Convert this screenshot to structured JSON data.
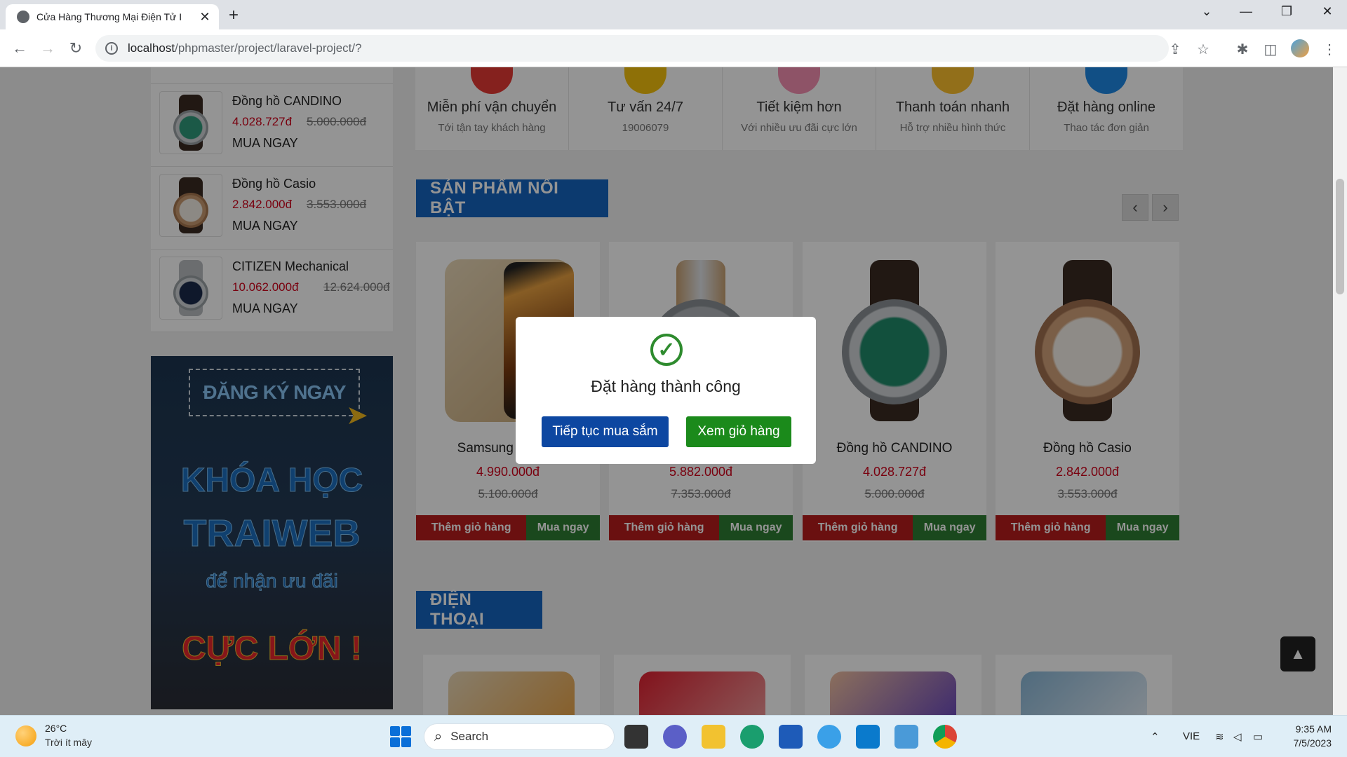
{
  "browser": {
    "tab_title": "Cửa Hàng Thương Mại Điện Tử I",
    "url_host": "localhost",
    "url_path": "/phpmaster/project/laravel-project/?",
    "new_tab": "+",
    "tab_close": "✕",
    "win_controls": [
      "⌄",
      "—",
      "❐",
      "✕"
    ]
  },
  "sidebar": {
    "products": [
      {
        "name": "Đồng hồ CANDINO",
        "price": "4.028.727đ",
        "old_price": "5.000.000đ",
        "buy": "MUA NGAY"
      },
      {
        "name": "Đồng hồ Casio",
        "price": "2.842.000đ",
        "old_price": "3.553.000đ",
        "buy": "MUA NGAY"
      },
      {
        "name": "CITIZEN Mechanical",
        "price": "10.062.000đ",
        "old_price": "12.624.000đ",
        "buy": "MUA NGAY"
      }
    ],
    "banner": {
      "register": "ĐĂNG KÝ NGAY",
      "line1": "KHÓA HỌC",
      "line2": "TRAIWEB",
      "line3": "để nhận ưu đãi",
      "line4": "CỰC LỚN !"
    }
  },
  "features": [
    {
      "title": "Miễn phí vận chuyển",
      "desc": "Tới tận tay khách hàng",
      "color": "#e53935"
    },
    {
      "title": "Tư vấn 24/7",
      "desc": "19006079",
      "color": "#f4c20d"
    },
    {
      "title": "Tiết kiệm hơn",
      "desc": "Với nhiều ưu đãi cực lớn",
      "color": "#f48fb1"
    },
    {
      "title": "Thanh toán nhanh",
      "desc": "Hỗ trợ nhiều hình thức",
      "color": "#fbc02d"
    },
    {
      "title": "Đặt hàng online",
      "desc": "Thao tác đơn giản",
      "color": "#1e88e5"
    }
  ],
  "featured": {
    "heading": "SẢN PHẨM NỔI BẬT",
    "prev": "‹",
    "next": "›",
    "products": [
      {
        "name": "Samsung Galaxy",
        "price": "4.990.000đ",
        "old_price": "5.100.000đ"
      },
      {
        "name": "",
        "price": "5.882.000đ",
        "old_price": "7.353.000đ"
      },
      {
        "name": "Đồng hồ CANDINO",
        "price": "4.028.727đ",
        "old_price": "5.000.000đ"
      },
      {
        "name": "Đồng hồ Casio",
        "price": "2.842.000đ",
        "old_price": "3.553.000đ"
      }
    ],
    "add_label": "Thêm giỏ hàng",
    "buy_label": "Mua ngay"
  },
  "phones": {
    "heading": "ĐIỆN THOẠI"
  },
  "modal": {
    "message": "Đặt hàng thành công",
    "continue": "Tiếp tục mua sắm",
    "view_cart": "Xem giỏ hàng"
  },
  "scroll_top": "▲",
  "taskbar": {
    "temp": "26°C",
    "weather": "Trời ít mây",
    "search": "Search",
    "lang": "VIE",
    "time": "9:35 AM",
    "date": "7/5/2023"
  }
}
